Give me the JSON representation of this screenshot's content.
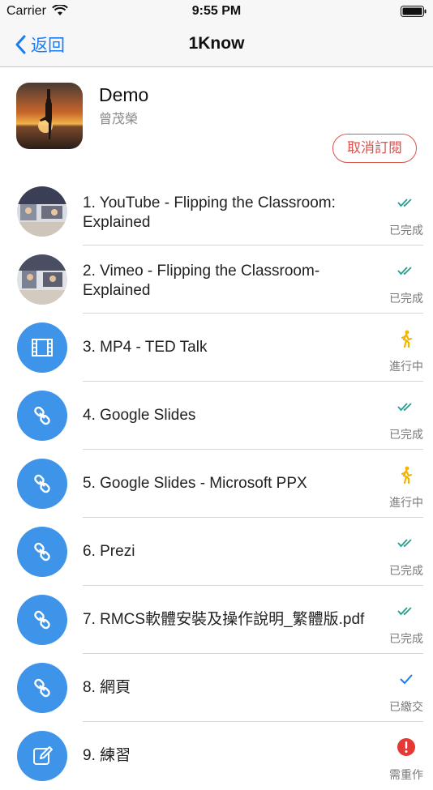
{
  "statusbar": {
    "carrier": "Carrier",
    "time": "9:55 PM"
  },
  "navbar": {
    "back_label": "返回",
    "title": "1Know"
  },
  "course": {
    "title": "Demo",
    "author": "曾茂榮",
    "unsubscribe_label": "取消訂閱"
  },
  "items": [
    {
      "title": "1. YouTube - Flipping the Classroom: Explained",
      "status": "已完成",
      "status_icon": "double-check-icon",
      "thumb": "video-thumbnail"
    },
    {
      "title": "2. Vimeo - Flipping the Classroom-Explained",
      "status": "已完成",
      "status_icon": "double-check-icon",
      "thumb": "video-thumbnail"
    },
    {
      "title": "3. MP4 - TED Talk",
      "status": "進行中",
      "status_icon": "walking-person-icon",
      "thumb": "film-icon"
    },
    {
      "title": "4. Google Slides",
      "status": "已完成",
      "status_icon": "double-check-icon",
      "thumb": "link-icon"
    },
    {
      "title": "5. Google Slides - Microsoft PPX",
      "status": "進行中",
      "status_icon": "walking-person-icon",
      "thumb": "link-icon"
    },
    {
      "title": "6. Prezi",
      "status": "已完成",
      "status_icon": "double-check-icon",
      "thumb": "link-icon"
    },
    {
      "title": "7. RMCS軟體安裝及操作說明_繁體版.pdf",
      "status": "已完成",
      "status_icon": "double-check-icon",
      "thumb": "link-icon"
    },
    {
      "title": "8. 網頁",
      "status": "已繳交",
      "status_icon": "check-icon",
      "thumb": "link-icon"
    },
    {
      "title": "9. 練習",
      "status": "需重作",
      "status_icon": "alert-icon",
      "thumb": "edit-icon"
    }
  ],
  "colors": {
    "accent": "#1a7cf5",
    "item_icon_bg": "#3e94e8",
    "done": "#2a9d8f",
    "in_progress": "#f4b400",
    "submitted": "#1a7cf5",
    "redo": "#e53935",
    "unsubscribe": "#d9534f"
  }
}
